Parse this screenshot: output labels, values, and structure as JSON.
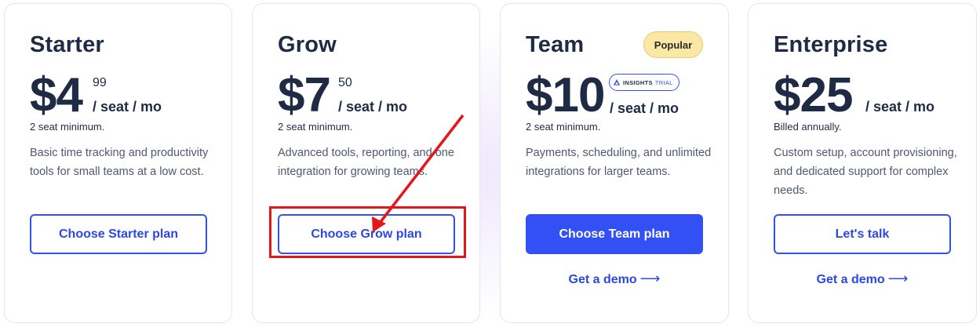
{
  "plans": [
    {
      "name": "Starter",
      "price": "$4",
      "cents": "99",
      "per": "/ seat / mo",
      "minimum": "2 seat minimum.",
      "description": "Basic time tracking and productivity tools for small teams at a low cost.",
      "cta": "Choose Starter plan"
    },
    {
      "name": "Grow",
      "price": "$7",
      "cents": "50",
      "per": "/ seat / mo",
      "minimum": "2 seat minimum.",
      "description": "Advanced tools, reporting, and one integration for growing teams.",
      "cta": "Choose Grow plan"
    },
    {
      "name": "Team",
      "badge": "Popular",
      "price": "$10",
      "trial_insights": "INSIGHTS",
      "trial_label": "TRIAL",
      "per": "/ seat / mo",
      "minimum": "2 seat minimum.",
      "description": "Payments, scheduling, and unlimited integrations for larger teams.",
      "cta": "Choose Team plan",
      "demo": "Get a demo"
    },
    {
      "name": "Enterprise",
      "price": "$25",
      "per": "/ seat / mo",
      "minimum": "Billed annually.",
      "description": "Custom setup, account provisioning, and dedicated support for complex needs.",
      "cta": "Let's talk",
      "demo": "Get a demo"
    }
  ],
  "colors": {
    "primary": "#3350f5",
    "heading": "#1f2a44",
    "body_text": "#4e5870",
    "popular_badge": "#fbe7a6",
    "annotation_red": "#e5151a"
  },
  "icons": {
    "trial_badge": "insights-triangle-icon",
    "demo_link": "arrow-right-icon"
  }
}
